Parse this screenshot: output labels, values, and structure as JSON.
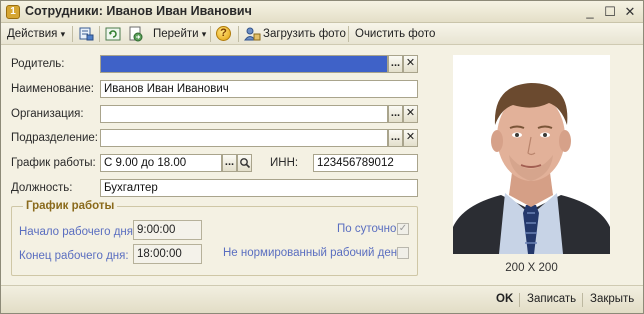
{
  "window": {
    "title": "Сотрудники: Иванов Иван Иванович",
    "minimize_glyph": "_",
    "maximize_glyph": "☐",
    "close_glyph": "✕"
  },
  "toolbar": {
    "actions_label": "Действия",
    "navigate_label": "Перейти",
    "help_glyph": "?",
    "upload_photo_label": "Загрузить фото",
    "clear_photo_label": "Очистить фото",
    "dropdown_glyph": "▾"
  },
  "form": {
    "parent": {
      "label": "Родитель:",
      "value": ""
    },
    "name": {
      "label": "Наименование:",
      "value": "Иванов Иван Иванович"
    },
    "organization": {
      "label": "Организация:",
      "value": ""
    },
    "department": {
      "label": "Подразделение:",
      "value": ""
    },
    "schedule": {
      "label": "График работы:",
      "value": "С 9.00 до 18.00"
    },
    "inn": {
      "label": "ИНН:",
      "value": "123456789012"
    },
    "position": {
      "label": "Должность:",
      "value": "Бухгалтер"
    },
    "select_glyph": "...",
    "clear_glyph": "✕",
    "search_glyph": "🔍"
  },
  "work_schedule": {
    "title": "График работы",
    "start_label": "Начало рабочего дня:",
    "start_value": "9:00:00",
    "end_label": "Конец рабочего дня:",
    "end_value": "18:00:00",
    "daily_label": "По суточно",
    "daily_checked": true,
    "irregular_label": "Не нормированный рабочий день",
    "irregular_checked": false,
    "check_glyph": "✓"
  },
  "photo": {
    "caption": "200 X 200"
  },
  "bottom": {
    "ok_label": "OK",
    "save_label": "Записать",
    "close_label": "Закрыть"
  },
  "colors": {
    "selection": "#3f62c8",
    "group_title": "#8a6a1c",
    "disabled_blue": "#5a6ec0"
  }
}
